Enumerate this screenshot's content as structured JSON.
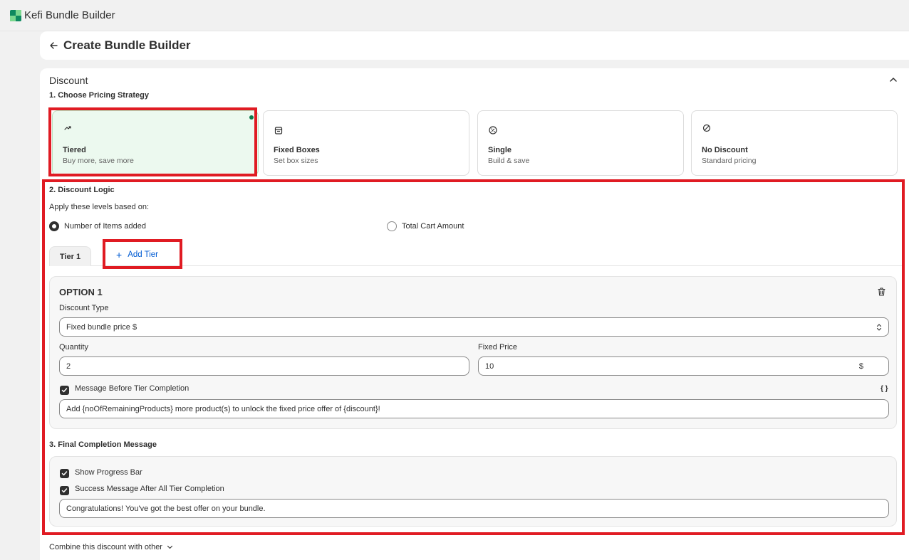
{
  "app": {
    "title": "Kefi Bundle Builder"
  },
  "header": {
    "back_icon": "arrow-left-icon",
    "title": "Create Bundle Builder"
  },
  "discount": {
    "section_title": "Discount",
    "step1": "1. Choose Pricing Strategy",
    "strategies": [
      {
        "name": "Tiered",
        "desc": "Buy more, save more",
        "icon": "trending-up-icon",
        "selected": true
      },
      {
        "name": "Fixed Boxes",
        "desc": "Set box sizes",
        "icon": "box-icon",
        "selected": false
      },
      {
        "name": "Single",
        "desc": "Build & save",
        "icon": "badge-percent-icon",
        "selected": false
      },
      {
        "name": "No Discount",
        "desc": "Standard pricing",
        "icon": "no-entry-icon",
        "selected": false
      }
    ],
    "step2": "2. Discount Logic",
    "apply_label": "Apply these levels based on:",
    "radio_items": "Number of Items added",
    "radio_cart": "Total Cart Amount",
    "tab_tier1": "Tier 1",
    "add_tier": "Add Tier",
    "option": {
      "title": "OPTION 1",
      "discount_type_label": "Discount Type",
      "discount_type_value": "Fixed bundle price $",
      "quantity_label": "Quantity",
      "quantity_value": "2",
      "fixed_price_label": "Fixed Price",
      "fixed_price_value": "10",
      "currency": "$",
      "message_before_label": "Message Before Tier Completion",
      "braces": "{ }",
      "message_before_value": "Add {noOfRemainingProducts} more product(s) to unlock the fixed price offer of {discount}!"
    },
    "step3": "3. Final Completion Message",
    "show_progress_label": "Show Progress Bar",
    "success_label": "Success Message After All Tier Completion",
    "success_value": "Congratulations! You've got the best offer on your bundle.",
    "combine_label": "Combine this discount with other"
  },
  "colors": {
    "highlight": "#e01b23",
    "selected_bg": "#ecf9ef",
    "link": "#005bd3",
    "dot": "#0b7a4b"
  }
}
